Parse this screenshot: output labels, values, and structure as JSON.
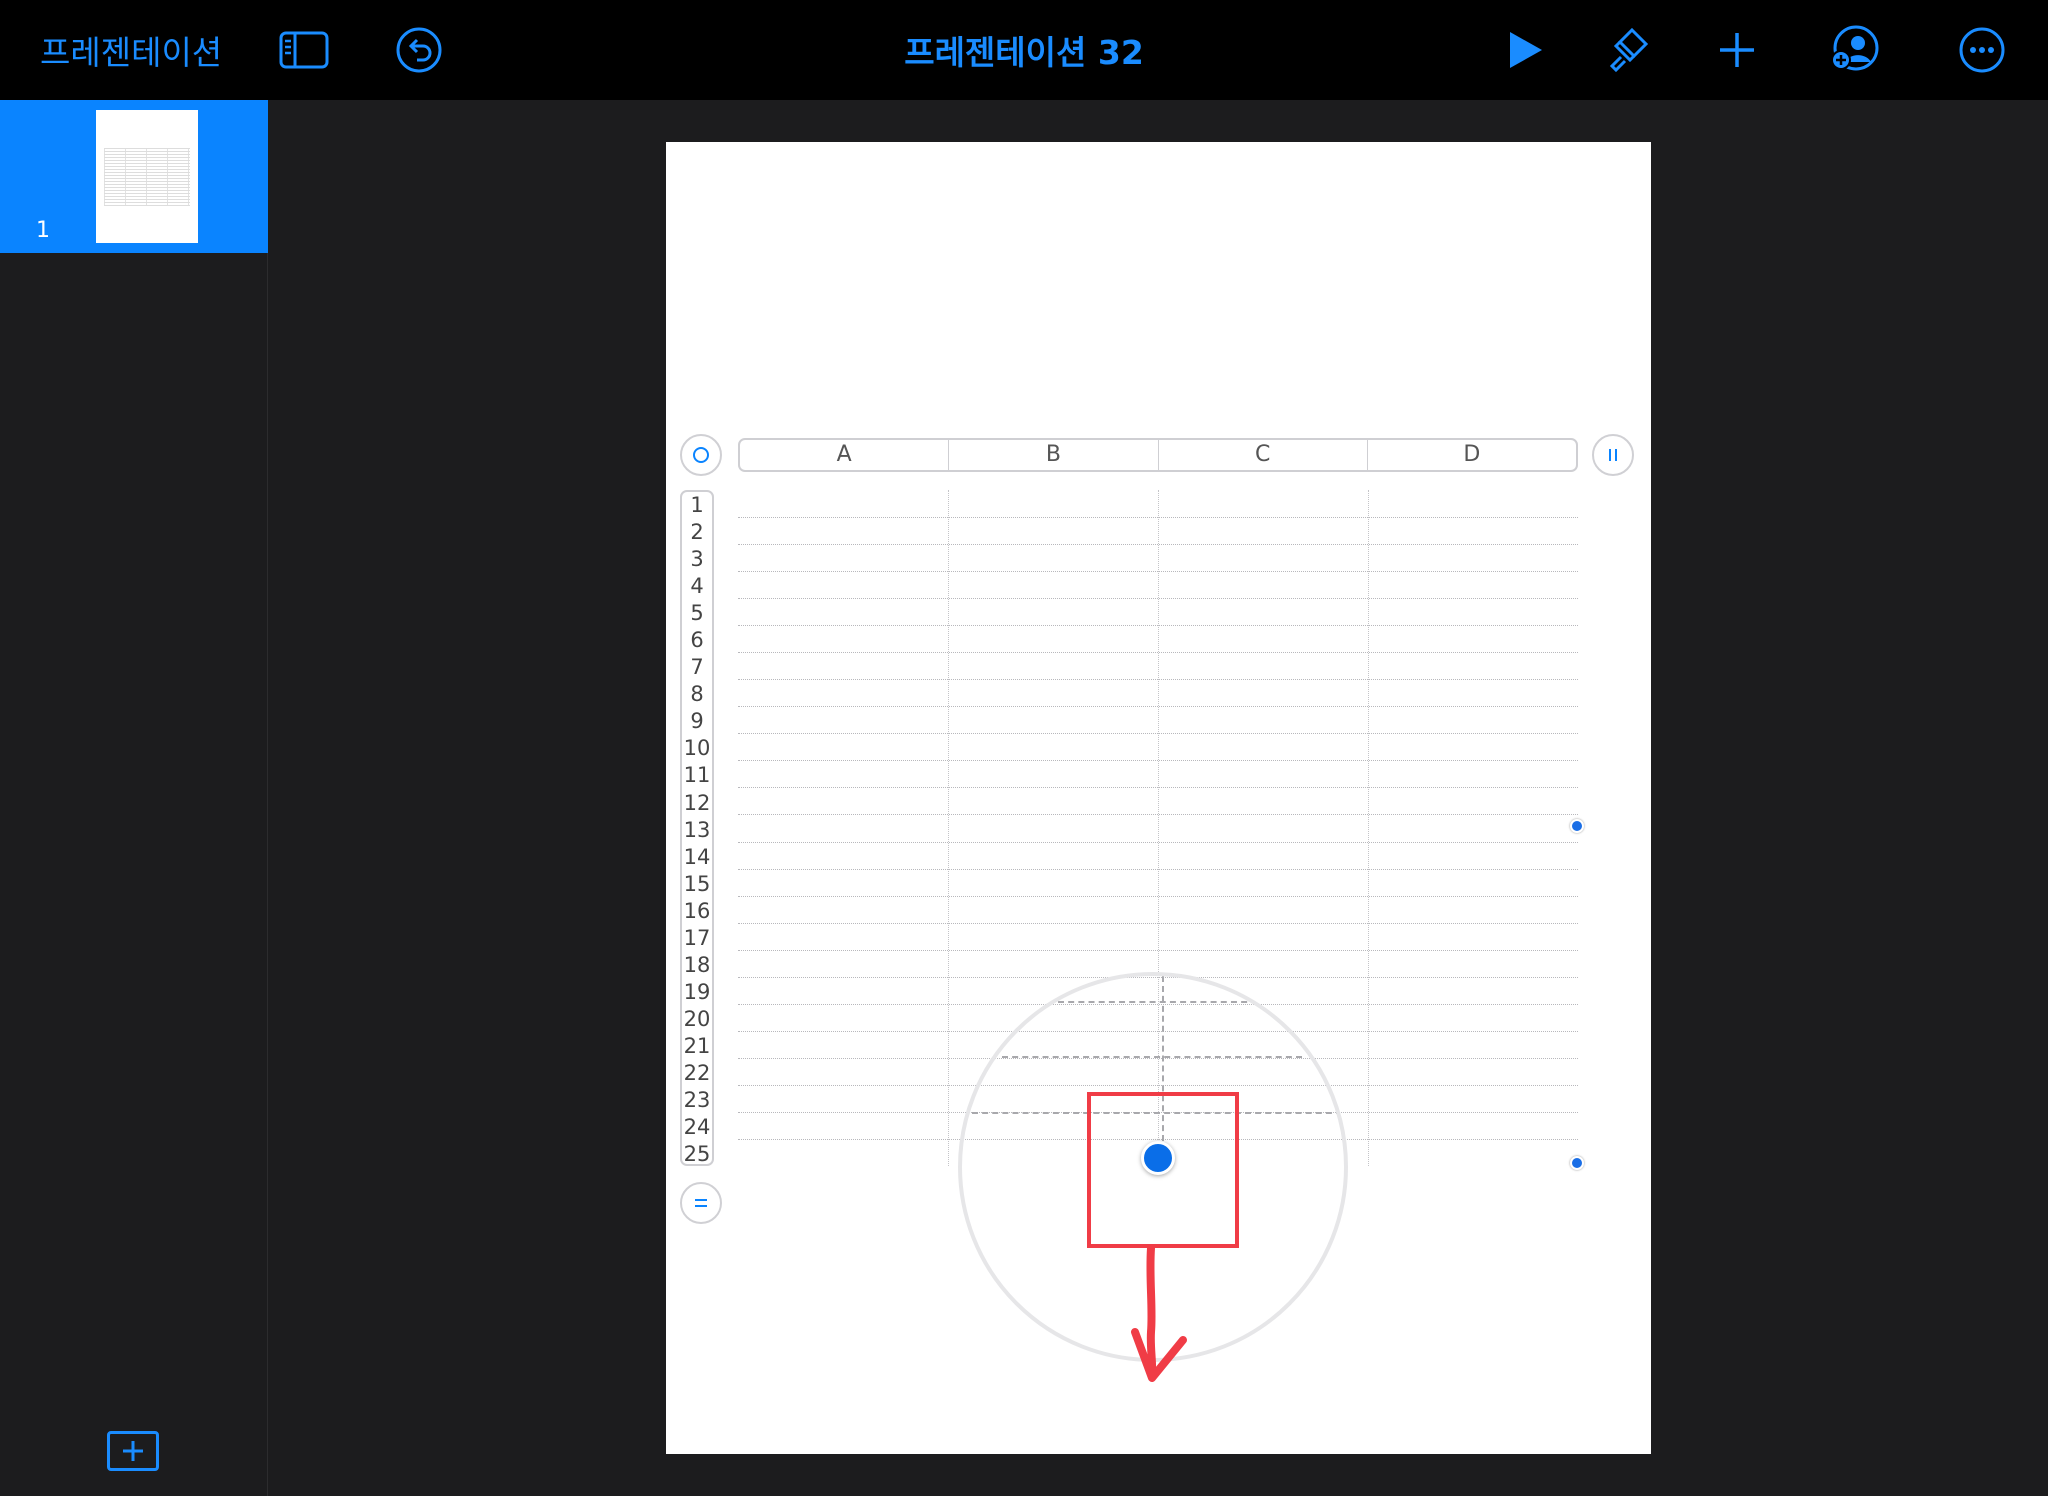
{
  "toolbar": {
    "back_label": "프레젠테이션",
    "document_title": "프레젠테이션 32",
    "icons": [
      "sidebar-toggle-icon",
      "undo-icon",
      "play-icon",
      "paintbrush-icon",
      "plus-icon",
      "collaborate-icon",
      "more-icon"
    ]
  },
  "navigator": {
    "slides": [
      {
        "number": "1",
        "selected": true
      }
    ]
  },
  "table": {
    "columns": [
      "A",
      "B",
      "C",
      "D"
    ],
    "rows": [
      "1",
      "2",
      "3",
      "4",
      "5",
      "6",
      "7",
      "8",
      "9",
      "10",
      "11",
      "12",
      "13",
      "14",
      "15",
      "16",
      "17",
      "18",
      "19",
      "20",
      "21",
      "22",
      "23",
      "24",
      "25"
    ]
  },
  "colors": {
    "accent": "#0a84ff",
    "toolbar_bg": "#000000",
    "canvas_bg": "#1c1c1e",
    "annotation": "#f03c46"
  }
}
